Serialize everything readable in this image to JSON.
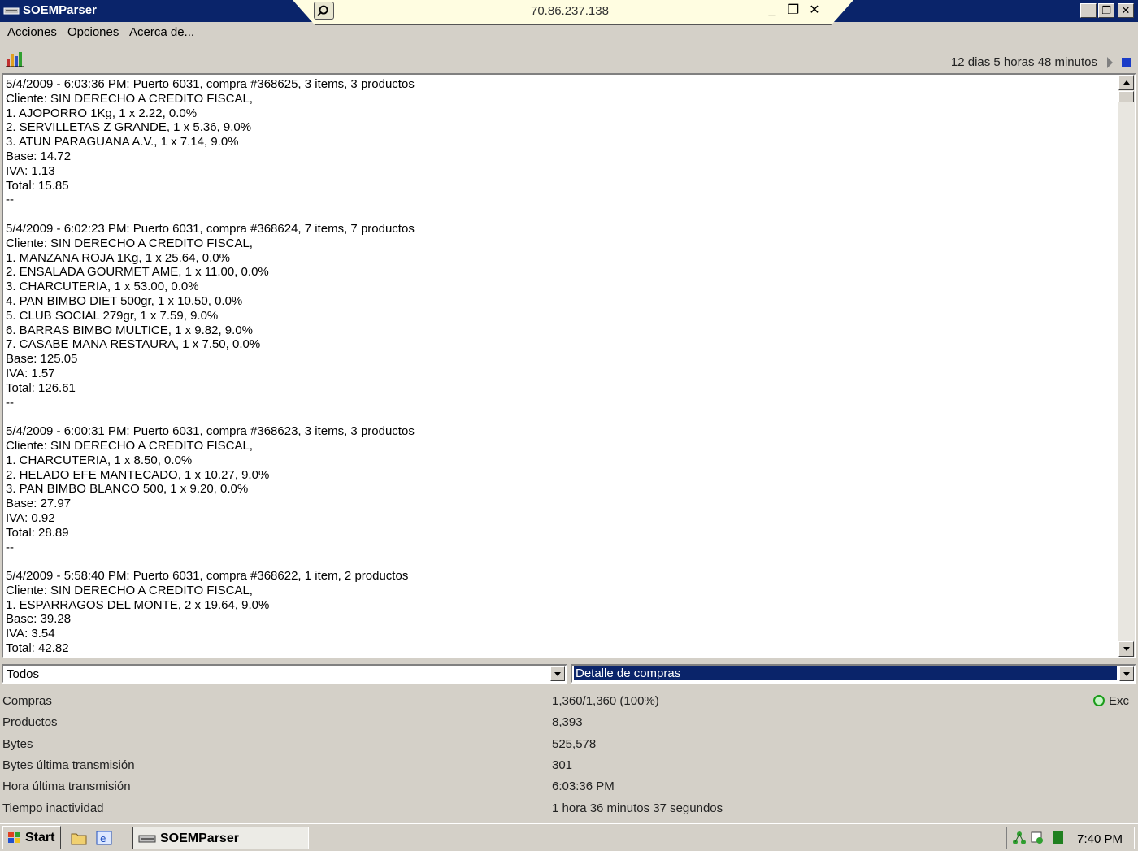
{
  "window": {
    "title": "SOEMParser",
    "rdp_address": "70.86.237.138"
  },
  "menu": {
    "items": [
      "Acciones",
      "Opciones",
      "Acerca de..."
    ]
  },
  "toolbar": {
    "uptime": "12 dias 5 horas 48 minutos"
  },
  "log": {
    "entries": [
      {
        "lines": [
          "5/4/2009 - 6:03:36 PM: Puerto 6031, compra #368625, 3 items, 3 productos",
          "Cliente: SIN DERECHO A CREDITO FISCAL,",
          "1. AJOPORRO 1Kg, 1 x 2.22, 0.0%",
          "2. SERVILLETAS Z GRANDE, 1 x 5.36, 9.0%",
          "3. ATUN PARAGUANA A.V., 1 x 7.14, 9.0%",
          "Base: 14.72",
          "IVA: 1.13",
          "Total: 15.85",
          "--"
        ]
      },
      {
        "lines": [
          "5/4/2009 - 6:02:23 PM: Puerto 6031, compra #368624, 7 items, 7 productos",
          "Cliente: SIN DERECHO A CREDITO FISCAL,",
          "1. MANZANA ROJA 1Kg, 1 x 25.64, 0.0%",
          "2. ENSALADA GOURMET AME, 1 x 11.00, 0.0%",
          "3. CHARCUTERIA, 1 x 53.00, 0.0%",
          "4. PAN BIMBO DIET 500gr, 1 x 10.50, 0.0%",
          "5. CLUB SOCIAL 279gr, 1 x 7.59, 9.0%",
          "6. BARRAS BIMBO MULTICE, 1 x 9.82, 9.0%",
          "7. CASABE MANA RESTAURA, 1 x 7.50, 0.0%",
          "Base: 125.05",
          "IVA: 1.57",
          "Total: 126.61",
          "--"
        ]
      },
      {
        "lines": [
          "5/4/2009 - 6:00:31 PM: Puerto 6031, compra #368623, 3 items, 3 productos",
          "Cliente: SIN DERECHO A CREDITO FISCAL,",
          "1. CHARCUTERIA, 1 x 8.50, 0.0%",
          "2. HELADO EFE MANTECADO, 1 x 10.27, 9.0%",
          "3. PAN BIMBO BLANCO 500, 1 x 9.20, 0.0%",
          "Base: 27.97",
          "IVA: 0.92",
          "Total: 28.89",
          "--"
        ]
      },
      {
        "lines": [
          "5/4/2009 - 5:58:40 PM: Puerto 6031, compra #368622, 1 item, 2 productos",
          "Cliente: SIN DERECHO A CREDITO FISCAL,",
          "1. ESPARRAGOS DEL MONTE, 2 x 19.64, 9.0%",
          "Base: 39.28",
          "IVA: 3.54",
          "Total: 42.82"
        ]
      }
    ]
  },
  "filters": {
    "left_value": "Todos",
    "right_value": "Detalle de compras"
  },
  "stats": [
    {
      "label": "Compras",
      "value": "1,360/1,360 (100%)"
    },
    {
      "label": "Productos",
      "value": "8,393"
    },
    {
      "label": "Bytes",
      "value": "525,578"
    },
    {
      "label": "Bytes última transmisión",
      "value": "301"
    },
    {
      "label": "Hora última transmisión",
      "value": "6:03:36 PM"
    },
    {
      "label": "Tiempo inactividad",
      "value": "1 hora 36 minutos 37 segundos"
    }
  ],
  "status": {
    "text": "Exc",
    "color": "#1a9c1a"
  },
  "taskbar": {
    "start_label": "Start",
    "task_label": "SOEMParser",
    "clock": "7:40 PM"
  }
}
